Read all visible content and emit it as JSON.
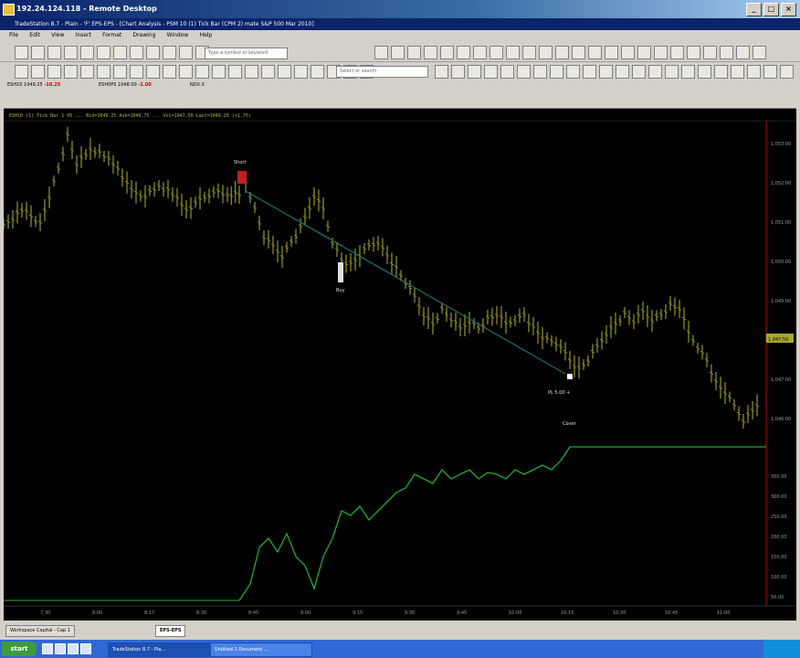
{
  "window": {
    "title": "192.24.124.118 - Remote Desktop",
    "controls": [
      "_",
      "□",
      "×"
    ]
  },
  "app": {
    "title": "TradeStation 8.7 - Plain - 'F' EPS-EPS - [Chart Analysis - PSM 10 (1) Tick Bar (CPM 2) mate S&P 500 Mar 2010]"
  },
  "menu": [
    "File",
    "Edit",
    "View",
    "Insert",
    "Format",
    "Drawing",
    "Window",
    "Help"
  ],
  "toolbar": {
    "combo1_placeholder": "Type a symbol or keyword",
    "combo2_placeholder": "Select or search"
  },
  "symbolbar": {
    "items": [
      {
        "label": "ESH10 1049.25",
        "value": "-10.25"
      },
      {
        "label": "ESH0PS 1048.00",
        "value": "-1.00"
      },
      {
        "label": "NDX.X",
        "value": ""
      }
    ]
  },
  "chart": {
    "header": "ESH10 (1) Tick Bar  1 05  ...  Bid=1049.25 Ask=1049.75 ... Vol=1047.50 Last=1049.25 (+1.75)",
    "price_labels": [
      "1,053.00",
      "1,052.00",
      "1,051.00",
      "1,050.00",
      "1,049.00",
      "1,048.00",
      "1,047.00",
      "1,046.00"
    ],
    "equity_labels": [
      "350.00",
      "300.00",
      "250.00",
      "200.00",
      "150.00",
      "100.00",
      "50.00"
    ],
    "time_labels": [
      "7:30",
      "8:00",
      "8:17",
      "8:30",
      "8:45",
      "9:00",
      "9:15",
      "9:30",
      "9:45",
      "10:00",
      "10:15",
      "10:30",
      "10:45",
      "11:00"
    ],
    "current_price_tag": "1,047.50",
    "annotations": {
      "entry": "Short",
      "exit": "Cover",
      "profit": "PL 5.00 +",
      "marker": "Buy"
    },
    "colors": {
      "bars": "#8a8a2a",
      "trendline": "#1f6b6b",
      "equity": "#1faa2f",
      "zero": "#3aa83a",
      "axis": "#c00000"
    }
  },
  "tabs": [
    {
      "label": "Workspace Capital - Cap 1",
      "active": false
    },
    {
      "label": "EPS-EPS",
      "active": true
    }
  ],
  "taskbar": {
    "start_label": "start",
    "tasks": [
      {
        "label": "TradeStation 8.7 - Pla...",
        "active": true
      },
      {
        "label": "Untitled-1 Document ...",
        "active": false
      }
    ]
  }
}
